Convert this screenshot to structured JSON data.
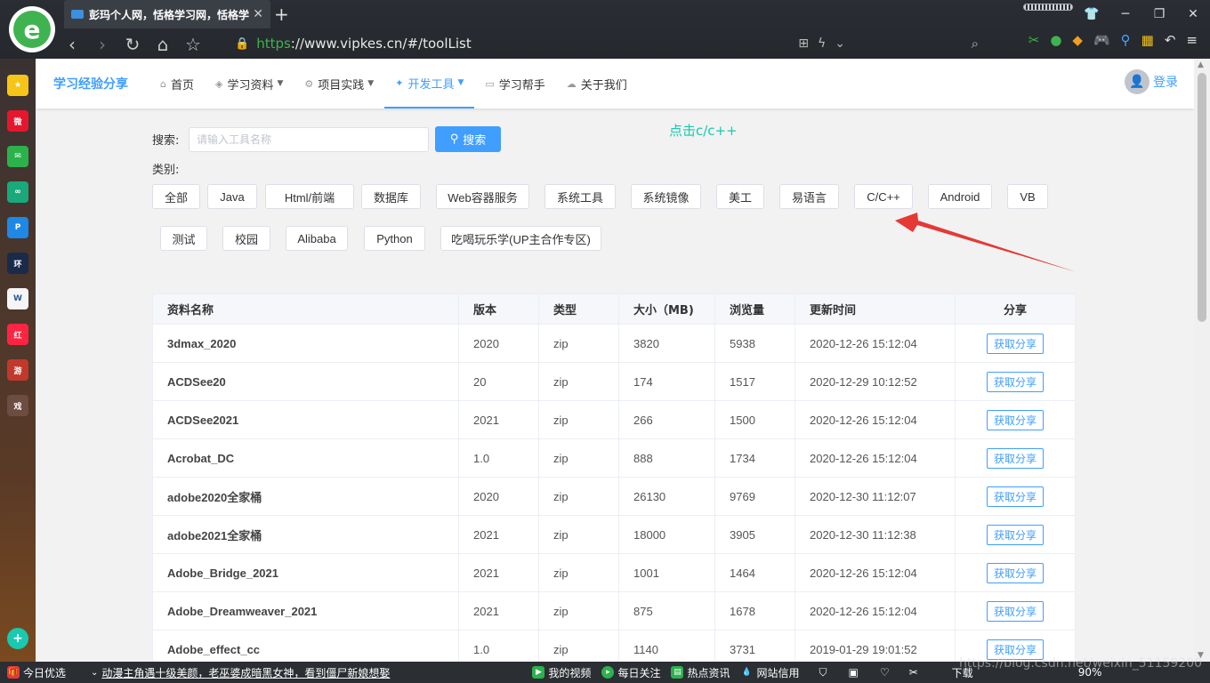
{
  "browser": {
    "tab_title": "彭玛个人网，恬格学习网，恬格学",
    "tab_close": "✕",
    "new_tab": "+",
    "url_scheme": "https",
    "url_rest": "://www.vipkes.cn/#/toolList",
    "win_min": "─",
    "win_restore": "❐",
    "win_close": "✕"
  },
  "site": {
    "brand": "学习经验分享",
    "nav": [
      {
        "label": "首页",
        "icon": "home-icon",
        "dropdown": false,
        "active": false
      },
      {
        "label": "学习资料",
        "icon": "book-icon",
        "dropdown": true,
        "active": false
      },
      {
        "label": "项目实践",
        "icon": "gear-icon",
        "dropdown": true,
        "active": false
      },
      {
        "label": "开发工具",
        "icon": "tools-icon",
        "dropdown": true,
        "active": true
      },
      {
        "label": "学习帮手",
        "icon": "helper-icon",
        "dropdown": false,
        "active": false
      },
      {
        "label": "关于我们",
        "icon": "about-icon",
        "dropdown": false,
        "active": false
      }
    ],
    "login": "登录"
  },
  "search": {
    "label": "搜索:",
    "placeholder": "请输入工具名称",
    "value": "",
    "button": "搜索"
  },
  "hint": "点击c/c++",
  "category": {
    "label": "类别:",
    "items": [
      "全部",
      "Java",
      "Html/前端",
      "数据库",
      "Web容器服务",
      "系统工具",
      "系统镜像",
      "美工",
      "易语言",
      "C/C++",
      "Android",
      "VB",
      "测试",
      "校园",
      "Alibaba",
      "Python",
      "吃喝玩乐学(UP主合作专区)"
    ]
  },
  "table": {
    "headers": [
      "资料名称",
      "版本",
      "类型",
      "大小（MB)",
      "浏览量",
      "更新时间",
      "分享"
    ],
    "share_label": "获取分享",
    "rows": [
      {
        "name": "3dmax_2020",
        "version": "2020",
        "type": "zip",
        "size": "3820",
        "views": "5938",
        "updated": "2020-12-26 15:12:04"
      },
      {
        "name": "ACDSee20",
        "version": "20",
        "type": "zip",
        "size": "174",
        "views": "1517",
        "updated": "2020-12-29 10:12:52"
      },
      {
        "name": "ACDSee2021",
        "version": "2021",
        "type": "zip",
        "size": "266",
        "views": "1500",
        "updated": "2020-12-26 15:12:04"
      },
      {
        "name": "Acrobat_DC",
        "version": "1.0",
        "type": "zip",
        "size": "888",
        "views": "1734",
        "updated": "2020-12-26 15:12:04"
      },
      {
        "name": "adobe2020全家桶",
        "version": "2020",
        "type": "zip",
        "size": "26130",
        "views": "9769",
        "updated": "2020-12-30 11:12:07"
      },
      {
        "name": "adobe2021全家桶",
        "version": "2021",
        "type": "zip",
        "size": "18000",
        "views": "3905",
        "updated": "2020-12-30 11:12:38"
      },
      {
        "name": "Adobe_Bridge_2021",
        "version": "2021",
        "type": "zip",
        "size": "1001",
        "views": "1464",
        "updated": "2020-12-26 15:12:04"
      },
      {
        "name": "Adobe_Dreamweaver_2021",
        "version": "2021",
        "type": "zip",
        "size": "875",
        "views": "1678",
        "updated": "2020-12-26 15:12:04"
      },
      {
        "name": "Adobe_effect_cc",
        "version": "1.0",
        "type": "zip",
        "size": "1140",
        "views": "3731",
        "updated": "2019-01-29 19:01:52"
      }
    ]
  },
  "statusbar": {
    "today": "今日优选",
    "news": "动漫主角遇十级美颜，老巫婆成暗黑女神，看到僵尸新娘想娶",
    "my_video": "我的视频",
    "daily": "每日关注",
    "hot": "热点资讯",
    "credit": "网站信用",
    "download": "下载",
    "zoom": "90%"
  },
  "watermark": "https://blog.csdn.net/weixin_51159200",
  "colors": {
    "accent": "#409eff",
    "hint": "#19c9b0",
    "arrow": "#e53935"
  }
}
